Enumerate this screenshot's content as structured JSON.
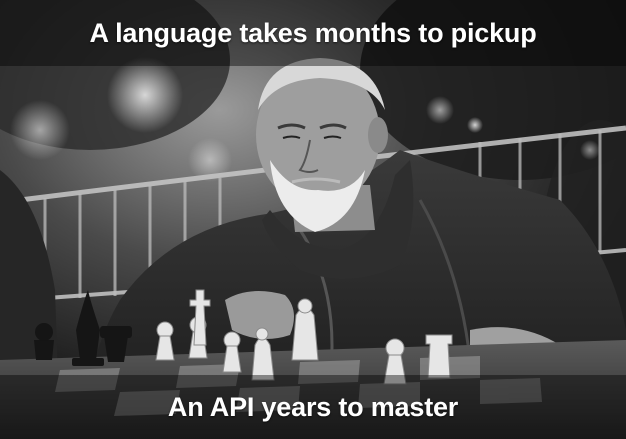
{
  "meme": {
    "top_caption": "A language takes months to pickup",
    "bottom_caption": "An API years to master"
  },
  "colors": {
    "caption_text": "#ffffff",
    "caption_band": "#000000"
  }
}
